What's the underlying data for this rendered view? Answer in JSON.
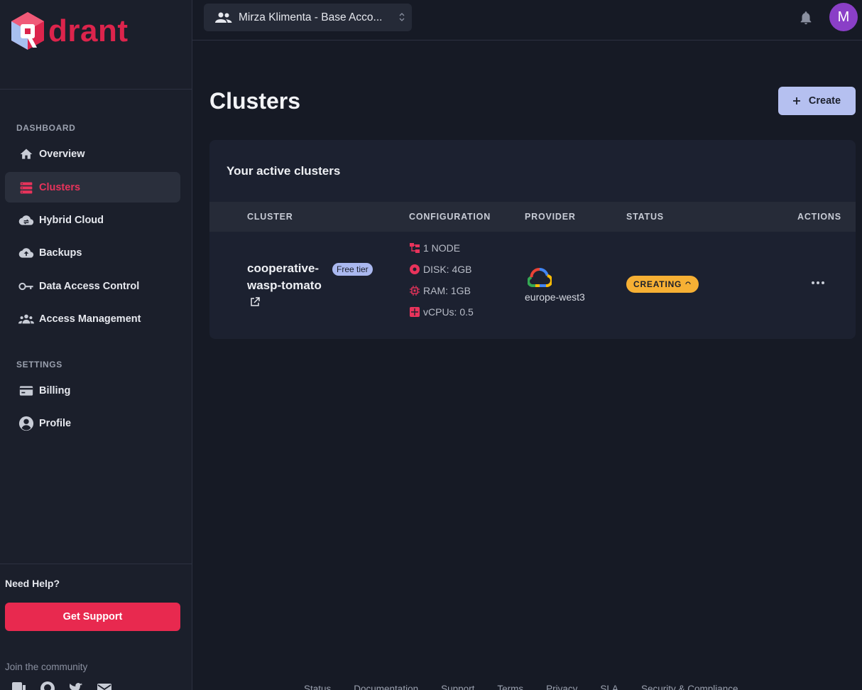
{
  "brand": {
    "logo_text": "drant",
    "accent": "#dc244c"
  },
  "sidebar": {
    "sections": [
      {
        "title": "DASHBOARD"
      },
      {
        "title": "SETTINGS"
      }
    ],
    "items": [
      {
        "label": "Overview",
        "icon": "home-icon"
      },
      {
        "label": "Clusters",
        "icon": "clusters-icon",
        "active": true
      },
      {
        "label": "Hybrid Cloud",
        "icon": "hybrid-cloud-icon"
      },
      {
        "label": "Backups",
        "icon": "backup-icon"
      },
      {
        "label": "Data Access Control",
        "icon": "key-icon"
      },
      {
        "label": "Access Management",
        "icon": "people-icon"
      },
      {
        "label": "Billing",
        "icon": "credit-card-icon"
      },
      {
        "label": "Profile",
        "icon": "profile-icon"
      }
    ],
    "help_title": "Need Help?",
    "support_button": "Get Support",
    "community_label": "Join the community",
    "social_icons": [
      "discord-icon",
      "github-icon",
      "twitter-icon",
      "mail-icon"
    ]
  },
  "topbar": {
    "account_label": "Mirza Klimenta - Base Acco...",
    "avatar_initial": "M"
  },
  "main": {
    "title": "Clusters",
    "create_button": "Create",
    "card_title": "Your active clusters",
    "columns": [
      "CLUSTER",
      "CONFIGURATION",
      "PROVIDER",
      "STATUS",
      "ACTIONS"
    ],
    "rows": [
      {
        "name_line1": "cooperative-",
        "name_line2": "wasp-tomato",
        "tier": "Free tier",
        "config": {
          "nodes": "1 NODE",
          "disk": "DISK: 4GB",
          "ram": "RAM: 1GB",
          "vcpus": "vCPUs: 0.5"
        },
        "provider_icon": "google-cloud-icon",
        "region": "europe-west3",
        "status": "CREATING",
        "status_color": "#f6b034"
      }
    ]
  },
  "footer": {
    "links": [
      "Status",
      "Documentation",
      "Support",
      "Terms",
      "Privacy",
      "SLA",
      "Security & Compliance"
    ]
  }
}
